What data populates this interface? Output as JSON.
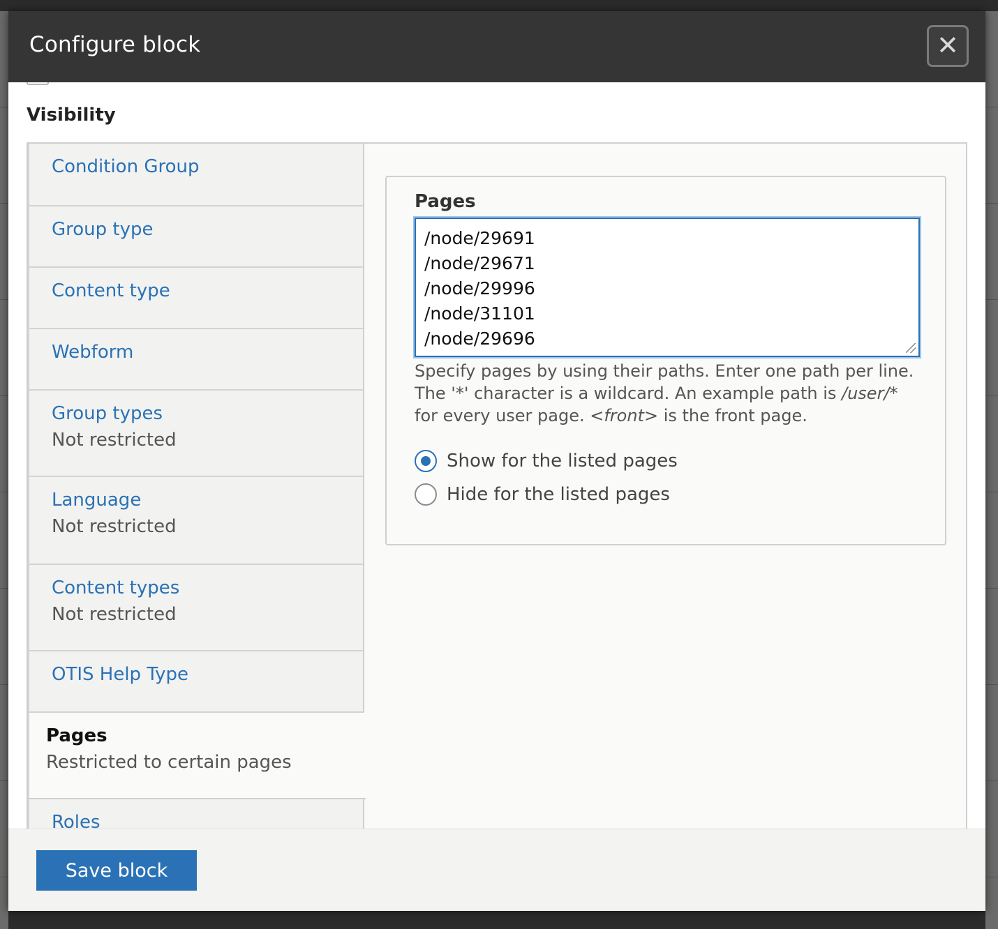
{
  "dialog": {
    "title": "Configure block",
    "close_symbol": "✕",
    "save_label": "Save block"
  },
  "visibility": {
    "heading": "Visibility",
    "tabs": [
      {
        "label": "Condition Group",
        "summary": ""
      },
      {
        "label": "Group type",
        "summary": ""
      },
      {
        "label": "Content type",
        "summary": ""
      },
      {
        "label": "Webform",
        "summary": ""
      },
      {
        "label": "Group types",
        "summary": "Not restricted"
      },
      {
        "label": "Language",
        "summary": "Not restricted"
      },
      {
        "label": "Content types",
        "summary": "Not restricted"
      },
      {
        "label": "OTIS Help Type",
        "summary": ""
      },
      {
        "label": "Pages",
        "summary": "Restricted to certain pages",
        "active": true
      },
      {
        "label": "Roles",
        "summary": ""
      }
    ]
  },
  "pages_pane": {
    "field_label": "Pages",
    "paths": "/node/29691\n/node/29671\n/node/29996\n/node/31101\n/node/29696",
    "description": {
      "part1": "Specify pages by using their paths. Enter one path per line. The '*' character is a wildcard. An example path is ",
      "example_path": "/user/*",
      "part2": " for every user page. ",
      "front": "<front>",
      "part3": " is the front page."
    },
    "radios": [
      {
        "label": "Show for the listed pages",
        "checked": true
      },
      {
        "label": "Hide for the listed pages",
        "checked": false
      }
    ]
  },
  "colors": {
    "accent": "#2a72b5",
    "titlebar": "#353535"
  }
}
